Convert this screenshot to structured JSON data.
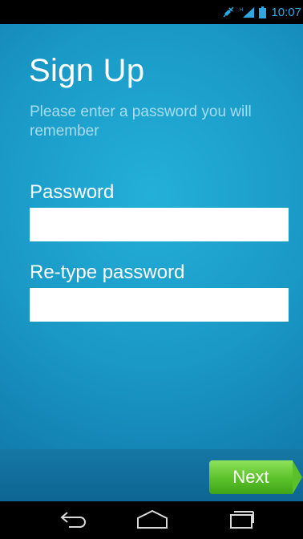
{
  "status_bar": {
    "time": "10:07",
    "icons": [
      "mute-icon",
      "signal-icon",
      "battery-icon"
    ],
    "accent_color": "#2fa8e0"
  },
  "form": {
    "title": "Sign Up",
    "subtitle": "Please enter a password you will remember",
    "password_label": "Password",
    "password_value": "",
    "retype_label": "Re-type password",
    "retype_value": ""
  },
  "footer": {
    "next_label": "Next",
    "next_color": "#5bc12a"
  },
  "nav_bar": {
    "icons": [
      "back-icon",
      "home-icon",
      "recent-apps-icon"
    ]
  },
  "colors": {
    "background": "#1a98c6",
    "bottom_bar": "#1677a5"
  }
}
